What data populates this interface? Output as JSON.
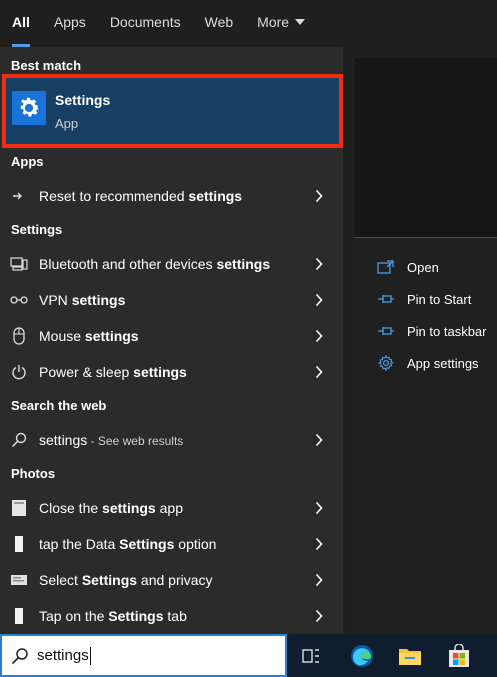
{
  "tabs": [
    {
      "label": "All"
    },
    {
      "label": "Apps"
    },
    {
      "label": "Documents"
    },
    {
      "label": "Web"
    },
    {
      "label": "More"
    }
  ],
  "sections": {
    "best_match": "Best match",
    "apps": "Apps",
    "settings": "Settings",
    "search_web": "Search the web",
    "photos": "Photos"
  },
  "best_match": {
    "title": "Settings",
    "subtitle": "App"
  },
  "apps_results": [
    {
      "pre": "Reset to recommended ",
      "bold": "settings",
      "post": ""
    }
  ],
  "settings_results": [
    {
      "pre": "Bluetooth and other devices ",
      "bold": "settings",
      "post": ""
    },
    {
      "pre": "VPN ",
      "bold": "settings",
      "post": ""
    },
    {
      "pre": "Mouse ",
      "bold": "settings",
      "post": ""
    },
    {
      "pre": "Power & sleep ",
      "bold": "settings",
      "post": ""
    }
  ],
  "web_result": {
    "query": "settings",
    "hint": " - See web results"
  },
  "photos_results": [
    {
      "pre": "Close the ",
      "bold": "settings",
      "post": " app"
    },
    {
      "pre": "tap the Data ",
      "bold": "Settings",
      "post": " option"
    },
    {
      "pre": "Select ",
      "bold": "Settings",
      "post": " and privacy"
    },
    {
      "pre": "Tap on the ",
      "bold": "Settings",
      "post": " tab"
    }
  ],
  "actions": [
    {
      "label": "Open",
      "icon": "open-icon"
    },
    {
      "label": "Pin to Start",
      "icon": "pin-icon"
    },
    {
      "label": "Pin to taskbar",
      "icon": "pin-icon"
    },
    {
      "label": "App settings",
      "icon": "gear-icon"
    }
  ],
  "search": {
    "value": "settings"
  },
  "colors": {
    "accent": "#4c9ee8",
    "highlight_border": "#f22c10",
    "selected_bg": "#173f63"
  }
}
